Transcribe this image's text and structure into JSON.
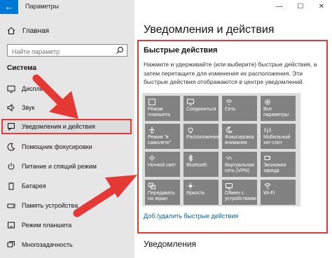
{
  "window": {
    "title": "Параметры",
    "back_icon": "arrow-left-icon",
    "minimize": "—",
    "maximize": "☐",
    "close": "✕"
  },
  "sidebar": {
    "home": "Главная",
    "search_placeholder": "Найти параметр",
    "section": "Система",
    "items": [
      {
        "label": "Дисплей",
        "icon": "display-icon"
      },
      {
        "label": "Звук",
        "icon": "speaker-icon"
      },
      {
        "label": "Уведомления и действия",
        "icon": "notification-icon",
        "active": true
      },
      {
        "label": "Помощник фокусировки",
        "icon": "moon-icon"
      },
      {
        "label": "Питание и спящий режим",
        "icon": "power-icon"
      },
      {
        "label": "Батарея",
        "icon": "battery-icon"
      },
      {
        "label": "Память устройства",
        "icon": "storage-icon"
      },
      {
        "label": "Режим планшета",
        "icon": "tablet-icon"
      },
      {
        "label": "Многозадачность",
        "icon": "multitask-icon"
      }
    ]
  },
  "main": {
    "title": "Уведомления и действия",
    "quick_actions": {
      "heading": "Быстрые действия",
      "description": "Нажмите и удерживайте (или выберите) быстрые действия, а затем перетащите для изменения их расположения. Эти быстрые действия отображаются в центре уведомлений.",
      "tiles": [
        {
          "label": "Режим планшета",
          "icon": "tablet-icon"
        },
        {
          "label": "Соединиться",
          "icon": "connect-icon"
        },
        {
          "label": "Сеть",
          "icon": "network-icon"
        },
        {
          "label": "Все параметры",
          "icon": "gear-icon"
        },
        {
          "label": "Режим \"в самолете\"",
          "icon": "airplane-icon"
        },
        {
          "label": "Расположение",
          "icon": "location-icon"
        },
        {
          "label": "Фокусировка внимания",
          "icon": "moon-icon"
        },
        {
          "label": "Мобильный хот-спот",
          "icon": "hotspot-icon"
        },
        {
          "label": "Ночной свет",
          "icon": "sun-icon"
        },
        {
          "label": "Bluetooth",
          "icon": "bluetooth-icon"
        },
        {
          "label": "Виртуальная сеть (VPN)",
          "icon": "vpn-icon"
        },
        {
          "label": "Экономия заряда",
          "icon": "battery-saver-icon"
        },
        {
          "label": "Передавать на экран",
          "icon": "project-icon"
        },
        {
          "label": "Яркость",
          "icon": "brightness-icon"
        },
        {
          "label": "Обмен с устройствами",
          "icon": "share-icon"
        },
        {
          "label": "Wi-Fi",
          "icon": "wifi-icon"
        }
      ],
      "link": "Доб./удалить быстрые действия"
    },
    "notifications_heading": "Уведомления"
  },
  "colors": {
    "accent": "#0078d7",
    "highlight": "#e53935",
    "tile": "#828282"
  }
}
